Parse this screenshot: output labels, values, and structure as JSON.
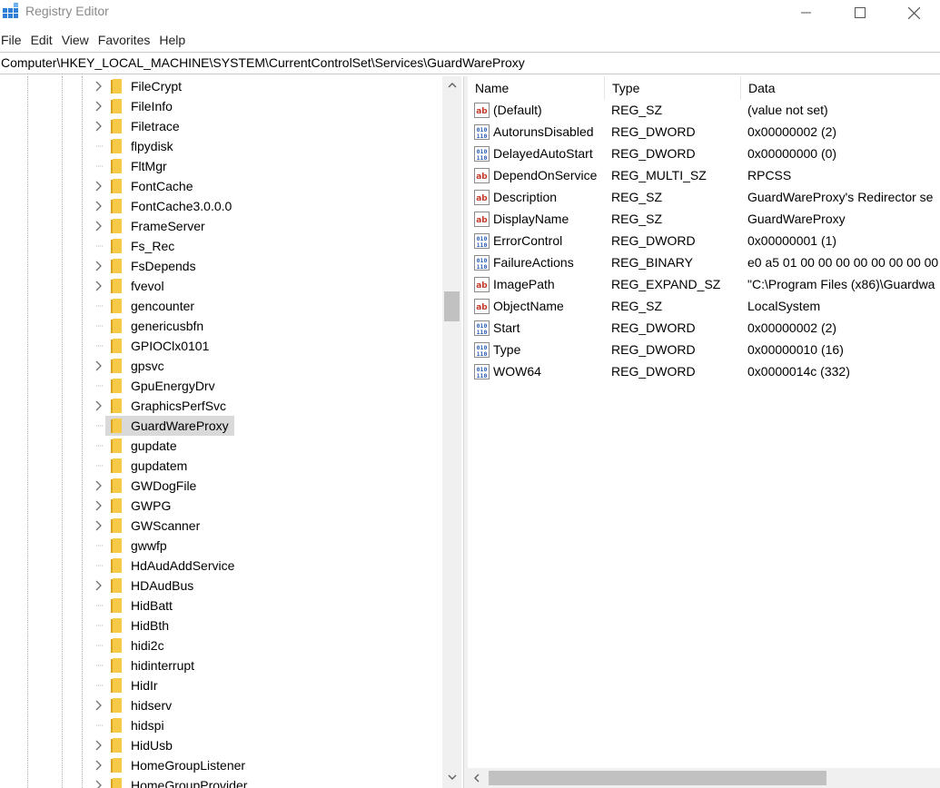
{
  "window": {
    "title": "Registry Editor"
  },
  "menu": [
    "File",
    "Edit",
    "View",
    "Favorites",
    "Help"
  ],
  "address": "Computer\\HKEY_LOCAL_MACHINE\\SYSTEM\\CurrentControlSet\\Services\\GuardWareProxy",
  "tree": {
    "items": [
      {
        "label": "FileCrypt",
        "expandable": true
      },
      {
        "label": "FileInfo",
        "expandable": true
      },
      {
        "label": "Filetrace",
        "expandable": true
      },
      {
        "label": "flpydisk",
        "expandable": false
      },
      {
        "label": "FltMgr",
        "expandable": false
      },
      {
        "label": "FontCache",
        "expandable": true
      },
      {
        "label": "FontCache3.0.0.0",
        "expandable": true
      },
      {
        "label": "FrameServer",
        "expandable": true
      },
      {
        "label": "Fs_Rec",
        "expandable": false
      },
      {
        "label": "FsDepends",
        "expandable": true
      },
      {
        "label": "fvevol",
        "expandable": true
      },
      {
        "label": "gencounter",
        "expandable": false
      },
      {
        "label": "genericusbfn",
        "expandable": false
      },
      {
        "label": "GPIOClx0101",
        "expandable": false
      },
      {
        "label": "gpsvc",
        "expandable": true
      },
      {
        "label": "GpuEnergyDrv",
        "expandable": false
      },
      {
        "label": "GraphicsPerfSvc",
        "expandable": true
      },
      {
        "label": "GuardWareProxy",
        "expandable": false,
        "selected": true
      },
      {
        "label": "gupdate",
        "expandable": false
      },
      {
        "label": "gupdatem",
        "expandable": false
      },
      {
        "label": "GWDogFile",
        "expandable": true
      },
      {
        "label": "GWPG",
        "expandable": true
      },
      {
        "label": "GWScanner",
        "expandable": true
      },
      {
        "label": "gwwfp",
        "expandable": false
      },
      {
        "label": "HdAudAddService",
        "expandable": false
      },
      {
        "label": "HDAudBus",
        "expandable": true
      },
      {
        "label": "HidBatt",
        "expandable": false
      },
      {
        "label": "HidBth",
        "expandable": false
      },
      {
        "label": "hidi2c",
        "expandable": false
      },
      {
        "label": "hidinterrupt",
        "expandable": false
      },
      {
        "label": "HidIr",
        "expandable": false
      },
      {
        "label": "hidserv",
        "expandable": true
      },
      {
        "label": "hidspi",
        "expandable": false
      },
      {
        "label": "HidUsb",
        "expandable": true
      },
      {
        "label": "HomeGroupListener",
        "expandable": true
      },
      {
        "label": "HomeGroupProvider",
        "expandable": true
      }
    ]
  },
  "list": {
    "columns": [
      "Name",
      "Type",
      "Data"
    ],
    "rows": [
      {
        "icon": "string-value-icon",
        "name": "(Default)",
        "type": "REG_SZ",
        "data": "(value not set)"
      },
      {
        "icon": "binary-value-icon",
        "name": "AutorunsDisabled",
        "type": "REG_DWORD",
        "data": "0x00000002 (2)"
      },
      {
        "icon": "binary-value-icon",
        "name": "DelayedAutoStart",
        "type": "REG_DWORD",
        "data": "0x00000000 (0)"
      },
      {
        "icon": "string-value-icon",
        "name": "DependOnService",
        "type": "REG_MULTI_SZ",
        "data": "RPCSS"
      },
      {
        "icon": "string-value-icon",
        "name": "Description",
        "type": "REG_SZ",
        "data": "GuardWareProxy's Redirector se"
      },
      {
        "icon": "string-value-icon",
        "name": "DisplayName",
        "type": "REG_SZ",
        "data": "GuardWareProxy"
      },
      {
        "icon": "binary-value-icon",
        "name": "ErrorControl",
        "type": "REG_DWORD",
        "data": "0x00000001 (1)"
      },
      {
        "icon": "binary-value-icon",
        "name": "FailureActions",
        "type": "REG_BINARY",
        "data": "e0 a5 01 00 00 00 00 00 00 00 00"
      },
      {
        "icon": "string-value-icon",
        "name": "ImagePath",
        "type": "REG_EXPAND_SZ",
        "data": "\"C:\\Program Files (x86)\\Guardwa"
      },
      {
        "icon": "string-value-icon",
        "name": "ObjectName",
        "type": "REG_SZ",
        "data": "LocalSystem"
      },
      {
        "icon": "binary-value-icon",
        "name": "Start",
        "type": "REG_DWORD",
        "data": "0x00000002 (2)"
      },
      {
        "icon": "binary-value-icon",
        "name": "Type",
        "type": "REG_DWORD",
        "data": "0x00000010 (16)"
      },
      {
        "icon": "binary-value-icon",
        "name": "WOW64",
        "type": "REG_DWORD",
        "data": "0x0000014c (332)"
      }
    ]
  },
  "colors": {
    "folder": "#f7c948",
    "selection": "#d9d9d9",
    "string_icon": "#c0392b",
    "binary_icon": "#2a5db0"
  }
}
